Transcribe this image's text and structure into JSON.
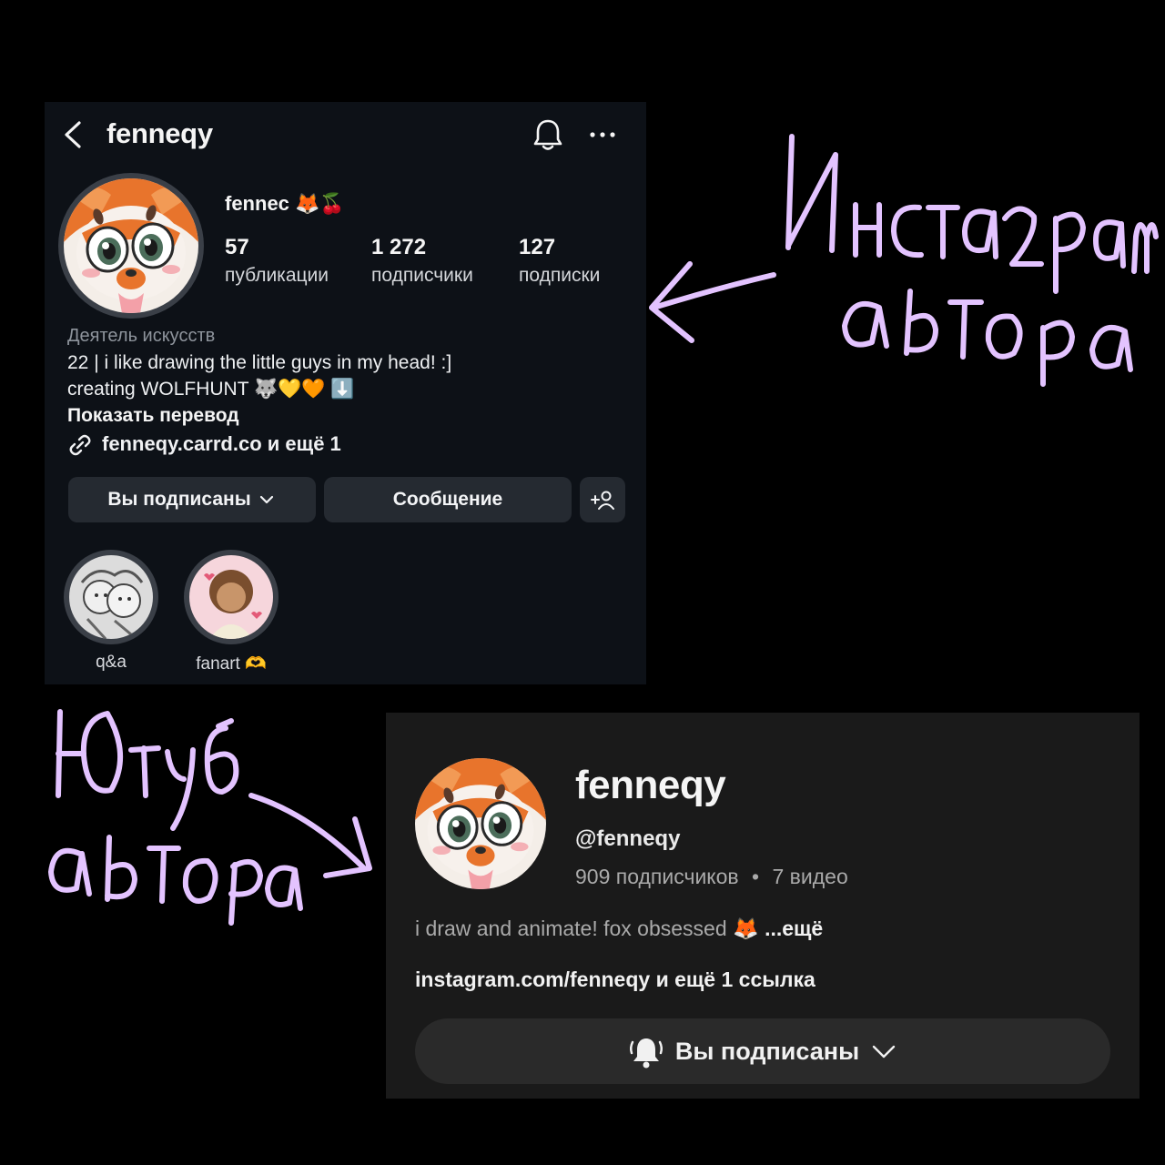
{
  "instagram": {
    "header": {
      "username": "fenneqy"
    },
    "profile": {
      "display_name": "fennec 🦊🍒",
      "stats": [
        {
          "value": "57",
          "label": "публикации"
        },
        {
          "value": "1 272",
          "label": "подписчики"
        },
        {
          "value": "127",
          "label": "подписки"
        }
      ],
      "category": "Деятель искусств",
      "bio_line1": "22 | i like drawing the little guys in my head! :]",
      "bio_line2": "creating WOLFHUNT 🐺💛🧡 ⬇️",
      "translate_label": "Показать перевод",
      "link_text": "fenneqy.carrd.co и ещё 1"
    },
    "buttons": {
      "following": "Вы подписаны",
      "message": "Сообщение"
    },
    "highlights": [
      {
        "label": "q&a"
      },
      {
        "label": "fanart 🫶"
      }
    ]
  },
  "youtube": {
    "channel_name": "fenneqy",
    "handle": "@fenneqy",
    "subscribers": "909 подписчиков",
    "separator": "•",
    "videos": "7 видео",
    "description": "i draw and animate! fox obsessed 🦊",
    "more_label": "...ещё",
    "links": "instagram.com/fenneqy и ещё 1 ссылка",
    "subscribed_label": "Вы подписаны"
  },
  "colors": {
    "ig_bg": "#0d1117",
    "yt_bg": "#1a1a1a",
    "annotation": "#e3c3ff",
    "fox_orange": "#e8742c"
  }
}
